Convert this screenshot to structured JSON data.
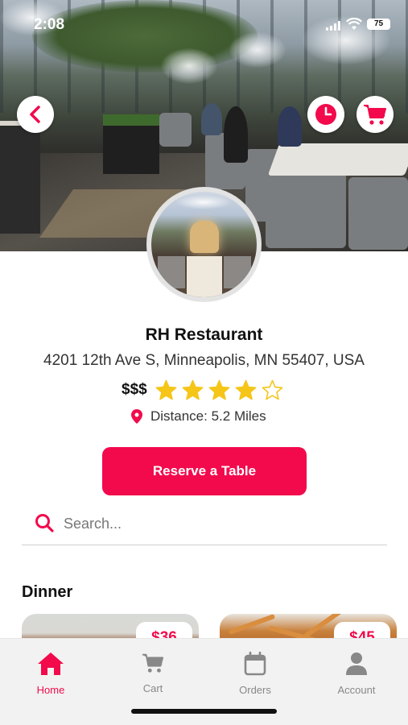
{
  "status_bar": {
    "time": "2:08",
    "battery": "75"
  },
  "header": {
    "back_icon": "chevron-left-icon",
    "history_icon": "clock-icon",
    "cart_icon": "cart-icon"
  },
  "restaurant": {
    "name": "RH Restaurant",
    "address": "4201 12th Ave S, Minneapolis, MN 55407, USA",
    "price_level": "$$$",
    "rating": 4,
    "rating_max": 5,
    "distance_text": "Distance: 5.2 Miles"
  },
  "actions": {
    "reserve_label": "Reserve a Table"
  },
  "search": {
    "placeholder": "Search...",
    "value": ""
  },
  "menu": {
    "section_title": "Dinner",
    "items": [
      {
        "price": "$36"
      },
      {
        "price": "$45"
      }
    ]
  },
  "tabbar": {
    "items": [
      {
        "label": "Home",
        "icon": "home-icon",
        "active": true
      },
      {
        "label": "Cart",
        "icon": "cart-icon",
        "active": false
      },
      {
        "label": "Orders",
        "icon": "calendar-icon",
        "active": false
      },
      {
        "label": "Account",
        "icon": "person-icon",
        "active": false
      }
    ]
  },
  "colors": {
    "accent": "#f20a4c",
    "star": "#f5c518"
  }
}
